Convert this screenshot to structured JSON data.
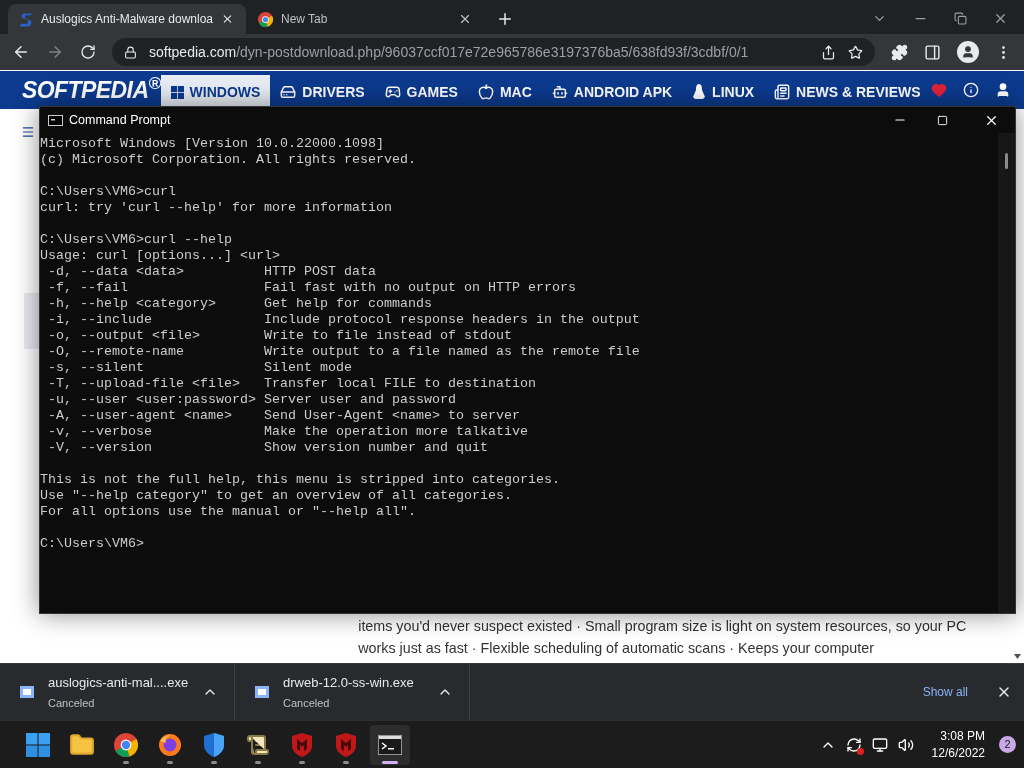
{
  "browser": {
    "tabs": [
      {
        "title": "Auslogics Anti-Malware downloa",
        "kind": "softpedia",
        "selected": true
      },
      {
        "title": "New Tab",
        "kind": "chrome",
        "selected": false
      }
    ],
    "url": {
      "host": "softpedia.com",
      "path": "/dyn-postdownload.php/96037ccf017e72e965786e3197376ba5/638fd93f/3cdbf/0/1"
    }
  },
  "site": {
    "logo": "SOFTPEDIA$^{®}$",
    "nav": [
      {
        "label": "WINDOWS",
        "kind": "windows",
        "selected": true
      },
      {
        "label": "DRIVERS",
        "kind": "drivers",
        "selected": false
      },
      {
        "label": "GAMES",
        "kind": "games",
        "selected": false
      },
      {
        "label": "MAC",
        "kind": "mac",
        "selected": false
      },
      {
        "label": "ANDROID APK",
        "kind": "android",
        "selected": false
      },
      {
        "label": "LINUX",
        "kind": "linux",
        "selected": false
      },
      {
        "label": "NEWS & REVIEWS",
        "kind": "news",
        "selected": false
      }
    ],
    "body_text": "items you'd never suspect existed · Small program size is light on system resources, so your PC works just as fast · Flexible scheduling of automatic scans · Keeps your computer"
  },
  "console": {
    "title": "Command Prompt",
    "blocks": [
      [
        "Microsoft Windows [Version 10.0.22000.1098]",
        "(c) Microsoft Corporation. All rights reserved."
      ],
      [
        "C:\\Users\\VM6>curl",
        "curl: try 'curl --help' for more information"
      ],
      [
        "C:\\Users\\VM6>curl --help",
        "Usage: curl [options...] <url>",
        " -d, --data <data>          HTTP POST data",
        " -f, --fail                 Fail fast with no output on HTTP errors",
        " -h, --help <category>      Get help for commands",
        " -i, --include              Include protocol response headers in the output",
        " -o, --output <file>        Write to file instead of stdout",
        " -O, --remote-name          Write output to a file named as the remote file",
        " -s, --silent               Silent mode",
        " -T, --upload-file <file>   Transfer local FILE to destination",
        " -u, --user <user:password> Server user and password",
        " -A, --user-agent <name>    Send User-Agent <name> to server",
        " -v, --verbose              Make the operation more talkative",
        " -V, --version              Show version number and quit"
      ],
      [
        "This is not the full help, this menu is stripped into categories.",
        "Use \"--help category\" to get an overview of all categories.",
        "For all options use the manual or \"--help all\"."
      ],
      [
        "C:\\Users\\VM6>"
      ]
    ]
  },
  "downloads": {
    "items": [
      {
        "name": "auslogics-anti-mal....exe",
        "status": "Canceled"
      },
      {
        "name": "drweb-12.0-ss-win.exe",
        "status": "Canceled"
      }
    ],
    "show_all": "Show all"
  },
  "taskbar": {
    "apps": [
      {
        "kind": "start",
        "running": false,
        "selected": false
      },
      {
        "kind": "folder",
        "running": false,
        "selected": false
      },
      {
        "kind": "chrome",
        "running": true,
        "selected": false
      },
      {
        "kind": "firefox",
        "running": true,
        "selected": false
      },
      {
        "kind": "shield",
        "running": true,
        "selected": false
      },
      {
        "kind": "notes",
        "running": true,
        "selected": false
      },
      {
        "kind": "mcafee",
        "running": true,
        "selected": false
      },
      {
        "kind": "mcafee",
        "running": true,
        "selected": false
      },
      {
        "kind": "terminal",
        "running": true,
        "selected": true
      }
    ],
    "time": "3:08 PM",
    "date": "12/6/2022",
    "notifications": "2"
  }
}
